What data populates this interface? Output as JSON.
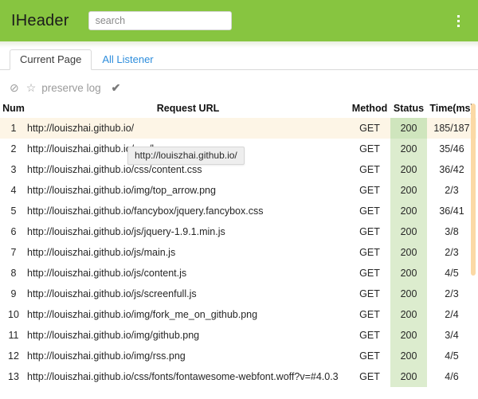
{
  "header": {
    "title": "IHeader",
    "search_placeholder": "search",
    "search_value": "",
    "menu_icon": "vertical-ellipsis-icon",
    "background_color": "#87c540"
  },
  "tabs": [
    {
      "label": "Current Page",
      "active": true
    },
    {
      "label": "All Listener",
      "active": false
    }
  ],
  "toolbar": {
    "clear_icon": "⊘",
    "star_icon": "☆",
    "preserve_log_label": "preserve log",
    "check_icon": "✔"
  },
  "table": {
    "columns": [
      "Num",
      "Request URL",
      "Method",
      "Status",
      "Time(ms)"
    ],
    "rows": [
      {
        "num": "1",
        "url": "http://louiszhai.github.io/",
        "method": "GET",
        "status": "200",
        "time": "185/187",
        "highlight": true
      },
      {
        "num": "2",
        "url": "http://louiszhai.github.io/css/base.css",
        "method": "GET",
        "status": "200",
        "time": "35/46",
        "highlight": false
      },
      {
        "num": "3",
        "url": "http://louiszhai.github.io/css/content.css",
        "method": "GET",
        "status": "200",
        "time": "36/42",
        "highlight": false
      },
      {
        "num": "4",
        "url": "http://louiszhai.github.io/img/top_arrow.png",
        "method": "GET",
        "status": "200",
        "time": "2/3",
        "highlight": false
      },
      {
        "num": "5",
        "url": "http://louiszhai.github.io/fancybox/jquery.fancybox.css",
        "method": "GET",
        "status": "200",
        "time": "36/41",
        "highlight": false
      },
      {
        "num": "6",
        "url": "http://louiszhai.github.io/js/jquery-1.9.1.min.js",
        "method": "GET",
        "status": "200",
        "time": "3/8",
        "highlight": false
      },
      {
        "num": "7",
        "url": "http://louiszhai.github.io/js/main.js",
        "method": "GET",
        "status": "200",
        "time": "2/3",
        "highlight": false
      },
      {
        "num": "8",
        "url": "http://louiszhai.github.io/js/content.js",
        "method": "GET",
        "status": "200",
        "time": "4/5",
        "highlight": false
      },
      {
        "num": "9",
        "url": "http://louiszhai.github.io/js/screenfull.js",
        "method": "GET",
        "status": "200",
        "time": "2/3",
        "highlight": false
      },
      {
        "num": "10",
        "url": "http://louiszhai.github.io/img/fork_me_on_github.png",
        "method": "GET",
        "status": "200",
        "time": "2/4",
        "highlight": false
      },
      {
        "num": "11",
        "url": "http://louiszhai.github.io/img/github.png",
        "method": "GET",
        "status": "200",
        "time": "3/4",
        "highlight": false
      },
      {
        "num": "12",
        "url": "http://louiszhai.github.io/img/rss.png",
        "method": "GET",
        "status": "200",
        "time": "4/5",
        "highlight": false
      },
      {
        "num": "13",
        "url": "http://louiszhai.github.io/css/fonts/fontawesome-webfont.woff?v=#4.0.3",
        "method": "GET",
        "status": "200",
        "time": "4/6",
        "highlight": false
      }
    ]
  },
  "tooltip": {
    "text": "http://louiszhai.github.io/"
  }
}
